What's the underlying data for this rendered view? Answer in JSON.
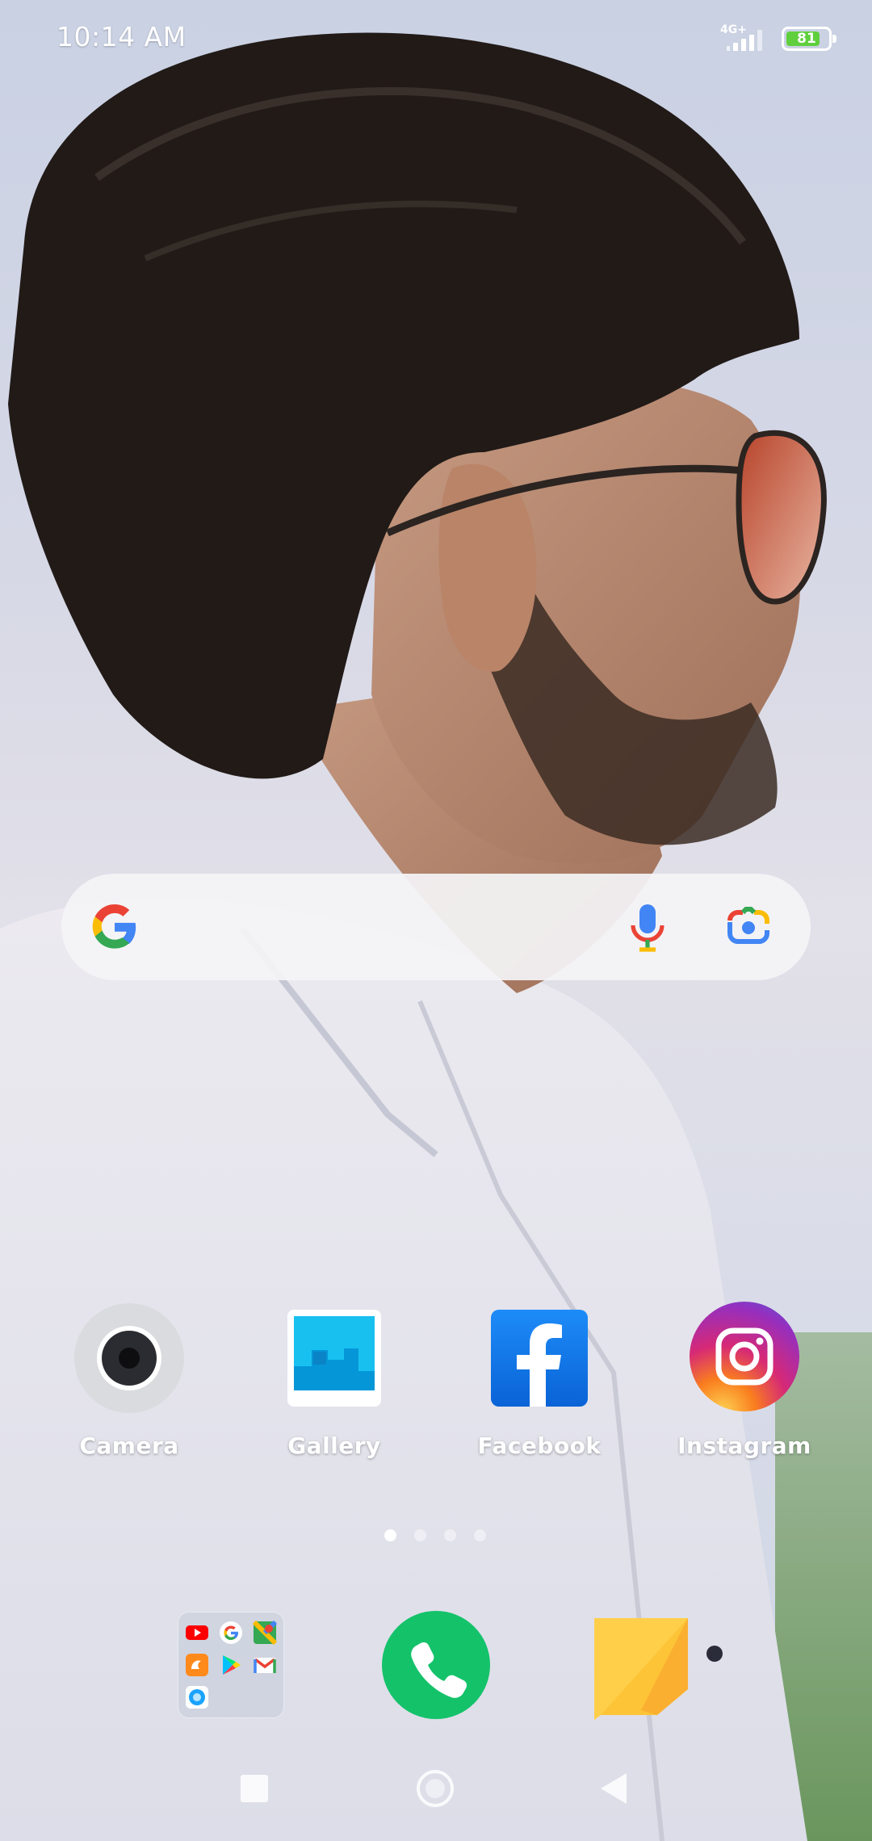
{
  "status_bar": {
    "time": "10:14 AM",
    "network": "4G+",
    "battery_percent": "81",
    "battery_level": 0.81
  },
  "search": {
    "placeholder": "",
    "icons": [
      "google-g-icon",
      "microphone-icon",
      "google-lens-icon"
    ]
  },
  "apps": [
    {
      "label": "Camera",
      "icon": "camera-icon"
    },
    {
      "label": "Gallery",
      "icon": "gallery-icon"
    },
    {
      "label": "Facebook",
      "icon": "facebook-icon"
    },
    {
      "label": "Instagram",
      "icon": "instagram-icon"
    }
  ],
  "page_indicator": {
    "pages": 4,
    "current": 1
  },
  "dock": {
    "folder_apps": [
      "youtube-icon",
      "google-icon",
      "maps-icon",
      "uc-browser-icon",
      "play-store-icon",
      "gmail-icon",
      "browser-icon"
    ],
    "items": [
      "app-folder",
      "phone-icon",
      "notes-icon"
    ]
  },
  "nav_bar": [
    "recents-button",
    "home-button",
    "back-button"
  ],
  "colors": {
    "phone_green": "#14c26a",
    "facebook_blue": "#1877f2",
    "battery_green": "#5fcf3d",
    "notes_yellow": "#fdc437"
  }
}
